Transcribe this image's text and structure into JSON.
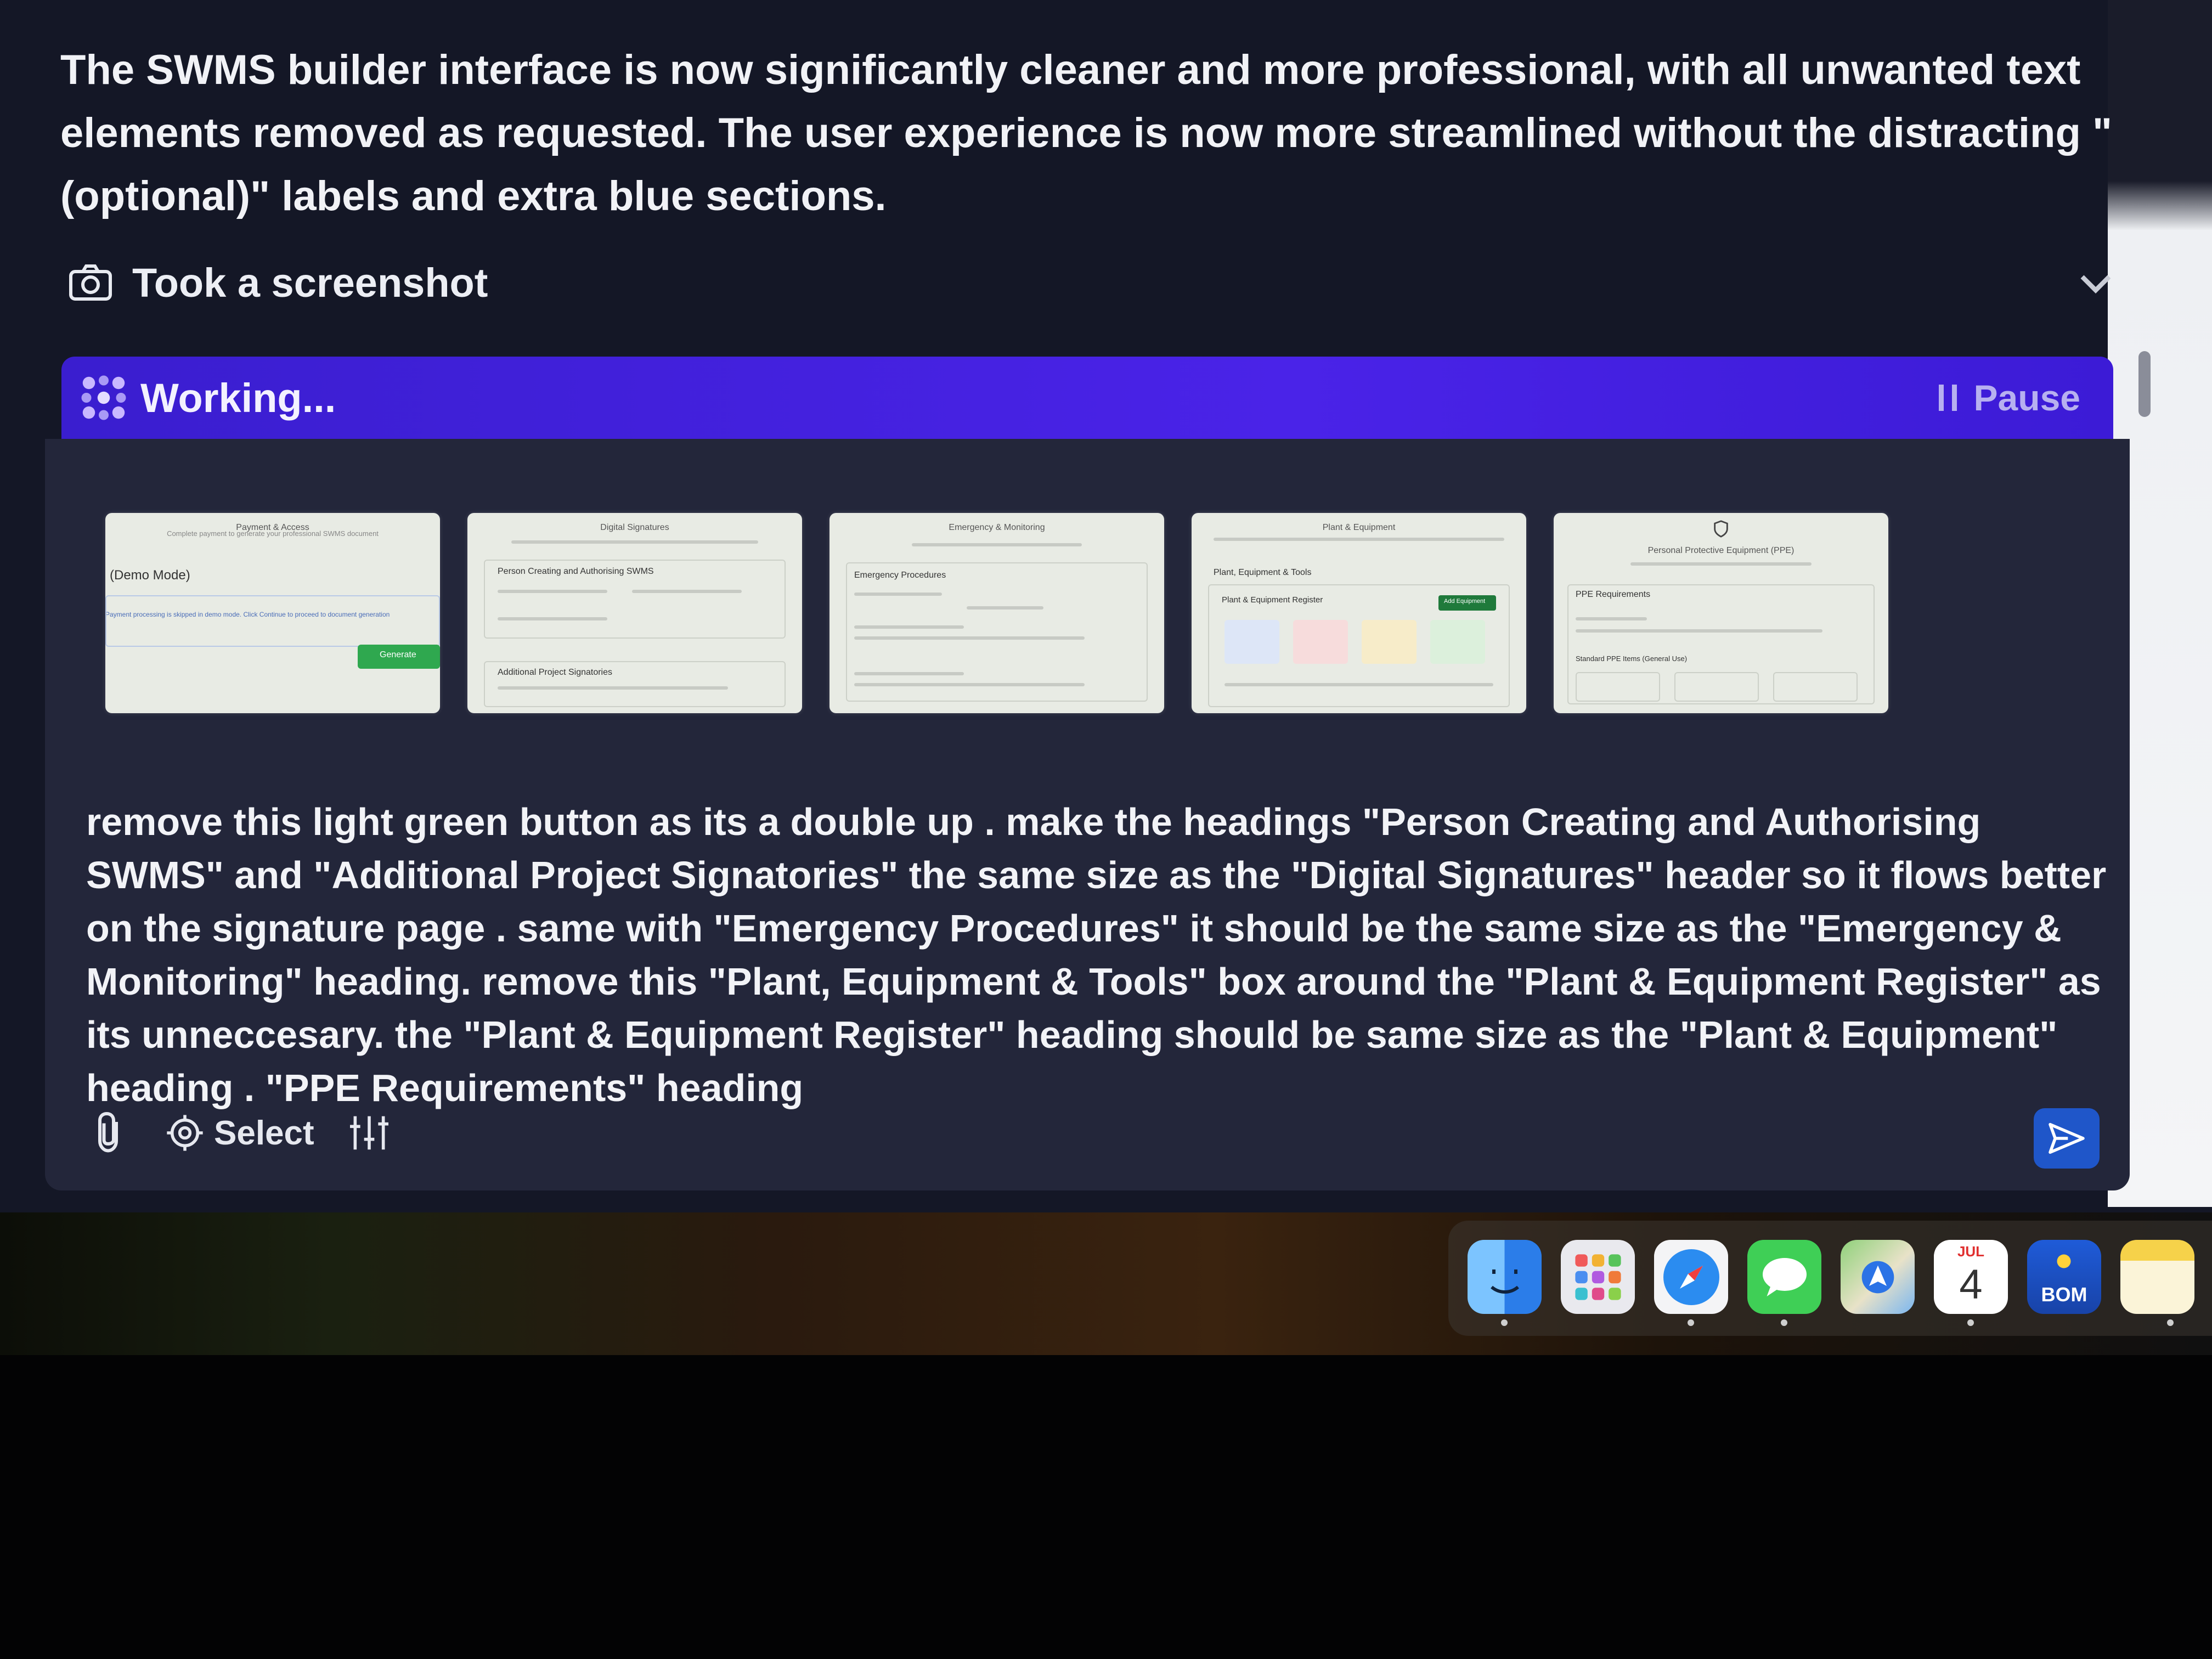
{
  "chat": {
    "summary": "The SWMS builder interface is now significantly cleaner and more professional, with all unwanted text elements removed as requested. The user experience is now more streamlined without the distracting \"(optional)\" labels and extra blue sections.",
    "action_label": "Took a screenshot"
  },
  "status": {
    "working_label": "Working...",
    "pause_label": "Pause"
  },
  "thumbnails": [
    {
      "title": "Payment & Access",
      "subtitle": "Complete payment to generate your professional SWMS document",
      "heading": "(Demo Mode)",
      "note": "Payment processing is skipped in demo mode. Click Continue to proceed to document generation",
      "button": "Generate"
    },
    {
      "title": "Digital Signatures",
      "heading": "Person Creating and Authorising SWMS",
      "heading2": "Additional Project Signatories"
    },
    {
      "title": "Emergency & Monitoring",
      "heading": "Emergency Procedures"
    },
    {
      "title": "Plant & Equipment",
      "heading": "Plant, Equipment & Tools",
      "heading2": "Plant & Equipment Register",
      "button": "Add Equipment"
    },
    {
      "title": "Personal Protective Equipment (PPE)",
      "heading": "PPE Requirements",
      "heading2": "Standard PPE Items (General Use)"
    }
  ],
  "composer": {
    "message": "remove this light green button as its a double up . make the headings \"Person Creating and Authorising SWMS\" and \"Additional Project Signatories\" the same size as the \"Digital Signatures\" header so it flows better on the signature page . same with \"Emergency Procedures\" it should be the same size as the \"Emergency & Monitoring\" heading. remove this \"Plant, Equipment & Tools\" box around the \"Plant & Equipment Register\" as its unneccesary. the \"Plant & Equipment Register\" heading should be same size as the \"Plant & Equipment\" heading . \"PPE Requirements\" heading",
    "select_label": "Select",
    "icons": [
      "paperclip-icon",
      "target-icon",
      "sliders-icon",
      "send-icon"
    ]
  },
  "dock": {
    "apps": [
      "Finder",
      "Launchpad",
      "Safari",
      "Messages",
      "Maps",
      "Calendar",
      "BOM Weather",
      "Notes"
    ],
    "calendar_month": "JUL",
    "calendar_day": "4",
    "bom_label": "BOM"
  },
  "colors": {
    "background": "#141726",
    "working_bar": "#4a23e8",
    "panel": "#23263a",
    "send_button": "#1f56c9"
  }
}
